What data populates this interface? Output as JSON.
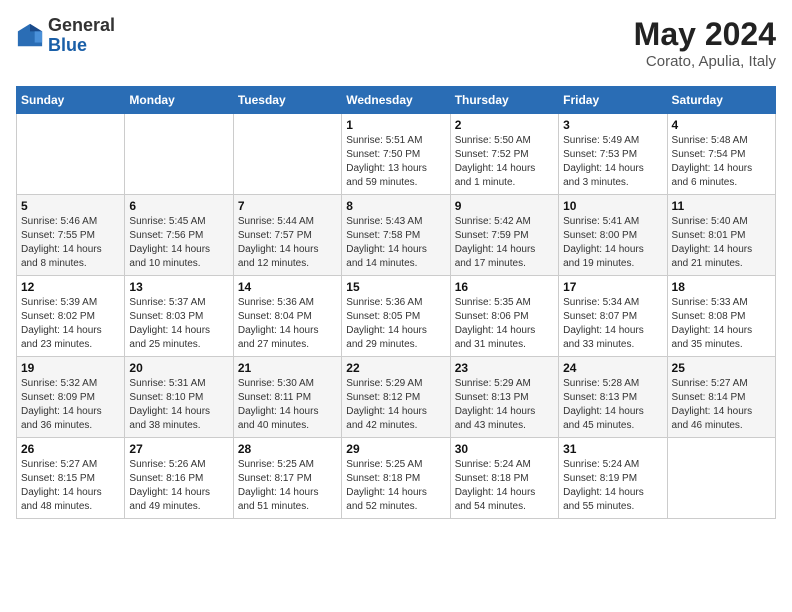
{
  "header": {
    "logo_general": "General",
    "logo_blue": "Blue",
    "title": "May 2024",
    "location": "Corato, Apulia, Italy"
  },
  "days_of_week": [
    "Sunday",
    "Monday",
    "Tuesday",
    "Wednesday",
    "Thursday",
    "Friday",
    "Saturday"
  ],
  "weeks": [
    [
      {
        "num": "",
        "sunrise": "",
        "sunset": "",
        "daylight": ""
      },
      {
        "num": "",
        "sunrise": "",
        "sunset": "",
        "daylight": ""
      },
      {
        "num": "",
        "sunrise": "",
        "sunset": "",
        "daylight": ""
      },
      {
        "num": "1",
        "sunrise": "Sunrise: 5:51 AM",
        "sunset": "Sunset: 7:50 PM",
        "daylight": "Daylight: 13 hours and 59 minutes."
      },
      {
        "num": "2",
        "sunrise": "Sunrise: 5:50 AM",
        "sunset": "Sunset: 7:52 PM",
        "daylight": "Daylight: 14 hours and 1 minute."
      },
      {
        "num": "3",
        "sunrise": "Sunrise: 5:49 AM",
        "sunset": "Sunset: 7:53 PM",
        "daylight": "Daylight: 14 hours and 3 minutes."
      },
      {
        "num": "4",
        "sunrise": "Sunrise: 5:48 AM",
        "sunset": "Sunset: 7:54 PM",
        "daylight": "Daylight: 14 hours and 6 minutes."
      }
    ],
    [
      {
        "num": "5",
        "sunrise": "Sunrise: 5:46 AM",
        "sunset": "Sunset: 7:55 PM",
        "daylight": "Daylight: 14 hours and 8 minutes."
      },
      {
        "num": "6",
        "sunrise": "Sunrise: 5:45 AM",
        "sunset": "Sunset: 7:56 PM",
        "daylight": "Daylight: 14 hours and 10 minutes."
      },
      {
        "num": "7",
        "sunrise": "Sunrise: 5:44 AM",
        "sunset": "Sunset: 7:57 PM",
        "daylight": "Daylight: 14 hours and 12 minutes."
      },
      {
        "num": "8",
        "sunrise": "Sunrise: 5:43 AM",
        "sunset": "Sunset: 7:58 PM",
        "daylight": "Daylight: 14 hours and 14 minutes."
      },
      {
        "num": "9",
        "sunrise": "Sunrise: 5:42 AM",
        "sunset": "Sunset: 7:59 PM",
        "daylight": "Daylight: 14 hours and 17 minutes."
      },
      {
        "num": "10",
        "sunrise": "Sunrise: 5:41 AM",
        "sunset": "Sunset: 8:00 PM",
        "daylight": "Daylight: 14 hours and 19 minutes."
      },
      {
        "num": "11",
        "sunrise": "Sunrise: 5:40 AM",
        "sunset": "Sunset: 8:01 PM",
        "daylight": "Daylight: 14 hours and 21 minutes."
      }
    ],
    [
      {
        "num": "12",
        "sunrise": "Sunrise: 5:39 AM",
        "sunset": "Sunset: 8:02 PM",
        "daylight": "Daylight: 14 hours and 23 minutes."
      },
      {
        "num": "13",
        "sunrise": "Sunrise: 5:37 AM",
        "sunset": "Sunset: 8:03 PM",
        "daylight": "Daylight: 14 hours and 25 minutes."
      },
      {
        "num": "14",
        "sunrise": "Sunrise: 5:36 AM",
        "sunset": "Sunset: 8:04 PM",
        "daylight": "Daylight: 14 hours and 27 minutes."
      },
      {
        "num": "15",
        "sunrise": "Sunrise: 5:36 AM",
        "sunset": "Sunset: 8:05 PM",
        "daylight": "Daylight: 14 hours and 29 minutes."
      },
      {
        "num": "16",
        "sunrise": "Sunrise: 5:35 AM",
        "sunset": "Sunset: 8:06 PM",
        "daylight": "Daylight: 14 hours and 31 minutes."
      },
      {
        "num": "17",
        "sunrise": "Sunrise: 5:34 AM",
        "sunset": "Sunset: 8:07 PM",
        "daylight": "Daylight: 14 hours and 33 minutes."
      },
      {
        "num": "18",
        "sunrise": "Sunrise: 5:33 AM",
        "sunset": "Sunset: 8:08 PM",
        "daylight": "Daylight: 14 hours and 35 minutes."
      }
    ],
    [
      {
        "num": "19",
        "sunrise": "Sunrise: 5:32 AM",
        "sunset": "Sunset: 8:09 PM",
        "daylight": "Daylight: 14 hours and 36 minutes."
      },
      {
        "num": "20",
        "sunrise": "Sunrise: 5:31 AM",
        "sunset": "Sunset: 8:10 PM",
        "daylight": "Daylight: 14 hours and 38 minutes."
      },
      {
        "num": "21",
        "sunrise": "Sunrise: 5:30 AM",
        "sunset": "Sunset: 8:11 PM",
        "daylight": "Daylight: 14 hours and 40 minutes."
      },
      {
        "num": "22",
        "sunrise": "Sunrise: 5:29 AM",
        "sunset": "Sunset: 8:12 PM",
        "daylight": "Daylight: 14 hours and 42 minutes."
      },
      {
        "num": "23",
        "sunrise": "Sunrise: 5:29 AM",
        "sunset": "Sunset: 8:13 PM",
        "daylight": "Daylight: 14 hours and 43 minutes."
      },
      {
        "num": "24",
        "sunrise": "Sunrise: 5:28 AM",
        "sunset": "Sunset: 8:13 PM",
        "daylight": "Daylight: 14 hours and 45 minutes."
      },
      {
        "num": "25",
        "sunrise": "Sunrise: 5:27 AM",
        "sunset": "Sunset: 8:14 PM",
        "daylight": "Daylight: 14 hours and 46 minutes."
      }
    ],
    [
      {
        "num": "26",
        "sunrise": "Sunrise: 5:27 AM",
        "sunset": "Sunset: 8:15 PM",
        "daylight": "Daylight: 14 hours and 48 minutes."
      },
      {
        "num": "27",
        "sunrise": "Sunrise: 5:26 AM",
        "sunset": "Sunset: 8:16 PM",
        "daylight": "Daylight: 14 hours and 49 minutes."
      },
      {
        "num": "28",
        "sunrise": "Sunrise: 5:25 AM",
        "sunset": "Sunset: 8:17 PM",
        "daylight": "Daylight: 14 hours and 51 minutes."
      },
      {
        "num": "29",
        "sunrise": "Sunrise: 5:25 AM",
        "sunset": "Sunset: 8:18 PM",
        "daylight": "Daylight: 14 hours and 52 minutes."
      },
      {
        "num": "30",
        "sunrise": "Sunrise: 5:24 AM",
        "sunset": "Sunset: 8:18 PM",
        "daylight": "Daylight: 14 hours and 54 minutes."
      },
      {
        "num": "31",
        "sunrise": "Sunrise: 5:24 AM",
        "sunset": "Sunset: 8:19 PM",
        "daylight": "Daylight: 14 hours and 55 minutes."
      },
      {
        "num": "",
        "sunrise": "",
        "sunset": "",
        "daylight": ""
      }
    ]
  ]
}
